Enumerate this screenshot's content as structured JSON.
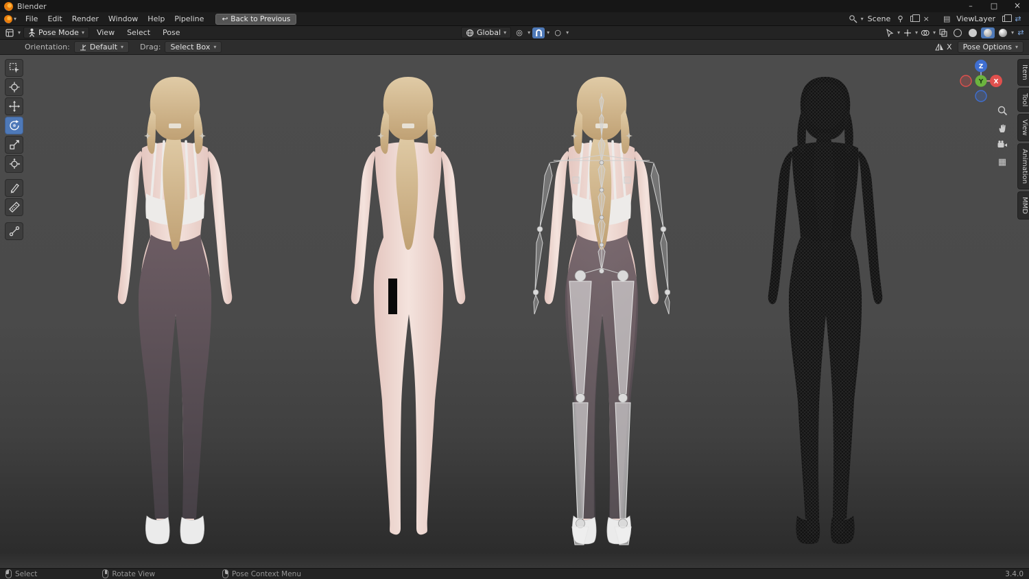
{
  "colors": {
    "accent": "#4e79b8",
    "skin": "#f3e2dc",
    "hair": "#d8c098",
    "pants": "#5d4f56",
    "axis_x": "#e0504d",
    "axis_y": "#6cb33e",
    "axis_z": "#3f6fd2"
  },
  "titlebar": {
    "title": "Blender",
    "minimize": "–",
    "maximize": "□",
    "close": "×"
  },
  "menubar": {
    "items": [
      "File",
      "Edit",
      "Render",
      "Window",
      "Help",
      "Pipeline"
    ],
    "back_icon": "↩",
    "back_label": "Back to Previous",
    "scene_label": "Scene",
    "viewlayer_label": "ViewLayer",
    "unlink_icon": "×",
    "swap_icon": "⇄",
    "layers_icon": "▤"
  },
  "header": {
    "mode": "Pose Mode",
    "menus": [
      "View",
      "Select",
      "Pose"
    ],
    "orientation": "Global",
    "pivot_icon": "◎",
    "proportional_icon": "○"
  },
  "tool_settings": {
    "orientation_label": "Orientation:",
    "orientation_value": "Default",
    "drag_label": "Drag:",
    "drag_value": "Select Box",
    "mirror_label": "X",
    "pose_options_label": "Pose Options"
  },
  "gizmo": {
    "x": "X",
    "y": "Y",
    "z": "Z"
  },
  "side_tabs": [
    "Item",
    "Tool",
    "View",
    "Animation",
    "MMD"
  ],
  "statusbar": {
    "hints": [
      {
        "label": "Select"
      },
      {
        "label": "Rotate View"
      },
      {
        "label": "Pose Context Menu"
      }
    ],
    "version": "3.4.0"
  },
  "misc": {
    "caret": "▾",
    "grid_icon": "▦"
  }
}
